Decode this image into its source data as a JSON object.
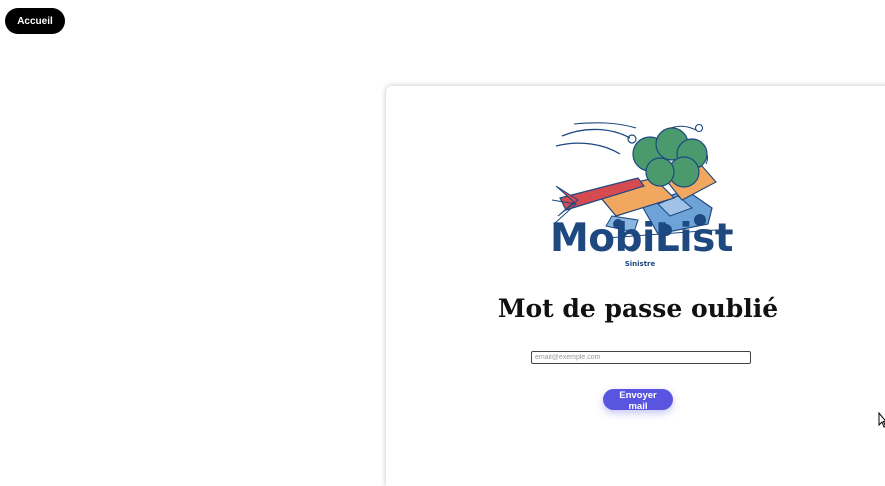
{
  "nav": {
    "home_label": "Accueil"
  },
  "logo": {
    "brand": "MobiList",
    "subtitle": "Sinistre"
  },
  "form": {
    "title": "Mot de passe oublié",
    "email_placeholder": "email@exemple.com",
    "submit_label": "Envoyer mail"
  },
  "colors": {
    "brand_blue": "#1d4880",
    "button_primary": "#5a55e0",
    "nav_button": "#000000"
  }
}
